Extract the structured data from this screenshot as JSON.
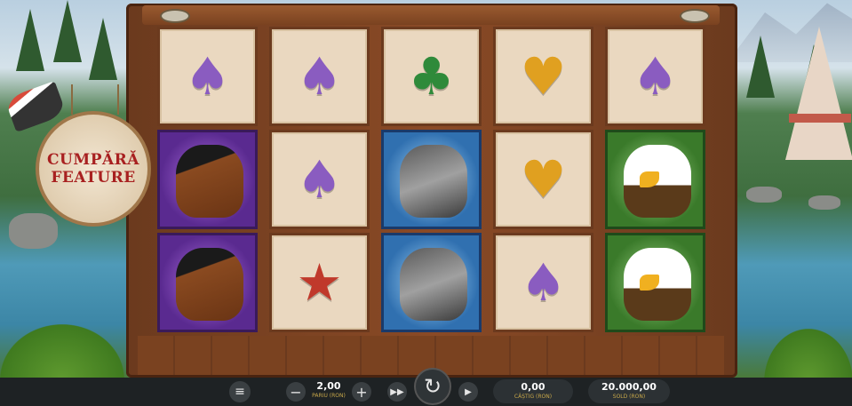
{
  "buy_feature": {
    "label": "CUMPĂRĂ FEATURE"
  },
  "reels": [
    [
      "spade",
      "horse",
      "horse"
    ],
    [
      "spade",
      "spade",
      "star"
    ],
    [
      "club",
      "wolf",
      "wolf"
    ],
    [
      "heart",
      "heart",
      "spade"
    ],
    [
      "spade",
      "eagle",
      "eagle"
    ]
  ],
  "symbol_glyphs": {
    "spade": "♠",
    "club": "♣",
    "heart": "♥",
    "star": "★"
  },
  "icons": {
    "menu": "menu-icon",
    "minus": "minus-icon",
    "plus": "plus-icon",
    "turbo": "fast-forward-icon",
    "spin": "spin-icon",
    "autoplay": "play-icon"
  },
  "controls": {
    "bet_value": "2,00",
    "bet_label": "PARIU (RON)",
    "win_value": "0,00",
    "win_label": "CÂȘTIG (RON)",
    "balance_value": "20.000,00",
    "balance_label": "SOLD (RON)"
  },
  "colors": {
    "buy_text": "#a82020",
    "bar": "#1e2224",
    "label_gold": "#c8a84a"
  }
}
